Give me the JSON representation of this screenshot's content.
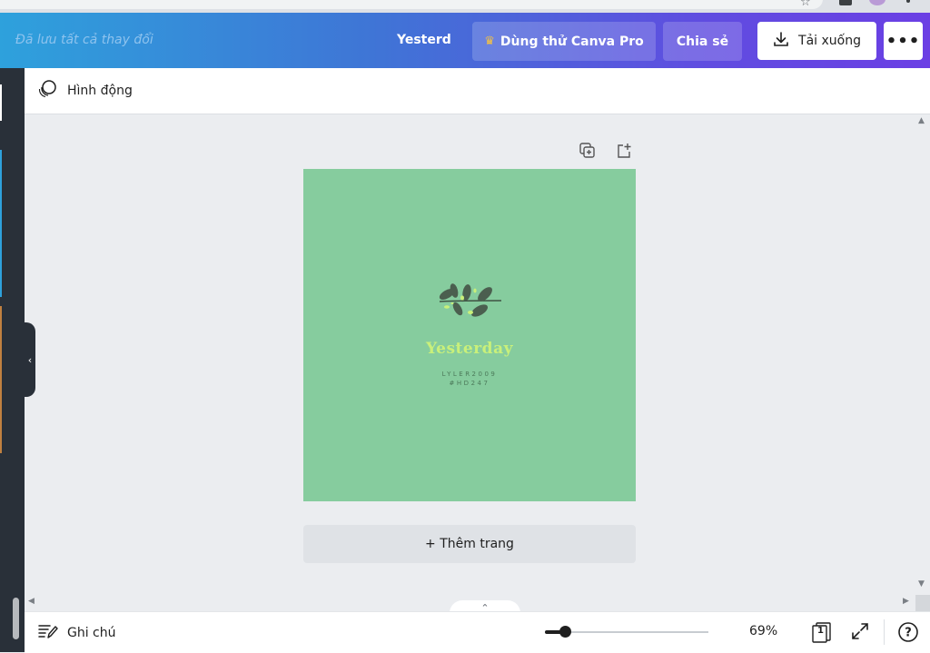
{
  "header": {
    "save_status": "Đã lưu tất cả thay đổi",
    "doc_title": "Yesterd",
    "try_pro_label": "Dùng thử Canva Pro",
    "share_label": "Chia sẻ",
    "download_label": "Tải xuống",
    "more_label": "•••"
  },
  "toolbar": {
    "animate_label": "Hình động"
  },
  "design": {
    "title": "Yesterday",
    "line1": "LYLER2009",
    "line2": "#HD247",
    "background_color": "#86cc9e",
    "title_color": "#c9f07a",
    "leaf_color": "#4b5f4f"
  },
  "canvas": {
    "add_page_label": "+ Thêm trang"
  },
  "footer": {
    "notes_label": "Ghi chú",
    "zoom_level": "69%",
    "zoom_fraction": 0.12,
    "page_count": "1"
  },
  "colors": {
    "accent_start": "#2ea1dc",
    "accent_end": "#6b3fe4",
    "sidebar": "#293039"
  },
  "icons": {
    "duplicate_page": "duplicate-page-icon",
    "add_page": "add-page-icon",
    "animation": "animation-icon",
    "notes": "notes-icon",
    "download": "download-icon",
    "crown": "crown-icon",
    "fullscreen": "fullscreen-icon",
    "help": "help-icon"
  }
}
